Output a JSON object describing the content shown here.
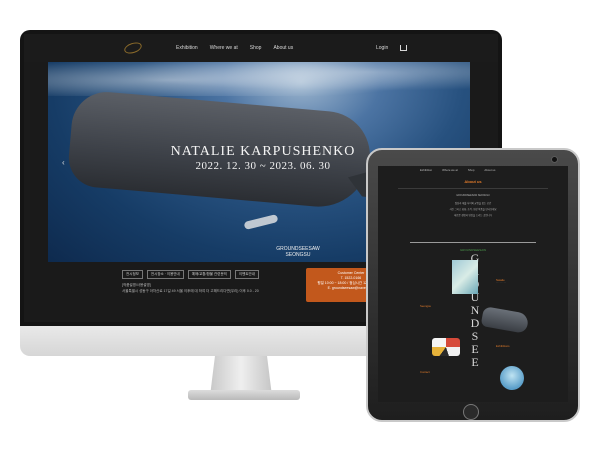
{
  "desktop": {
    "nav": {
      "links": [
        "Exhibition",
        "Where we at",
        "Shop",
        "About us"
      ],
      "login": "Login"
    },
    "hero": {
      "title": "NATALIE KARPUSHENKO",
      "dates": "2022. 12. 30 ~ 2023. 06. 30",
      "venue_line1": "GROUNDSEESAW",
      "venue_line2": "SEONGSU"
    },
    "tabs": [
      "전시정보",
      "전시장소 · 이용안내",
      "예매/교환/환불 관련문의",
      "이벤트안내"
    ],
    "info_heading": "[작품설명/사용설명]",
    "info_text": "서울특별시 성동구 아차산로 17길 49 서울 이후에 대 하여 더 고해드리다면(우리) 이후 0.0 - 20",
    "customer_center": {
      "title": "Customer Center",
      "phone": "T. 1522-0166",
      "hours": "평일 10:00 ~ 18:00 / 점심시간 12:00 ~ 13:00",
      "email": "E. groundseesaw@naver.com"
    }
  },
  "tablet": {
    "nav": [
      "Exhibition",
      "Where we at",
      "Shop",
      "About us"
    ],
    "title": "About us",
    "text_lines": [
      "GROUNDSEESAW SEONGSU",
      "일상과 예술 사이의 균형을 찾는 공간",
      "사진 그리고 회화, 조각, 영상 작품을 만나보세요",
      "새로운 경험과 영감을 드리는 곳입니다"
    ],
    "sub_heading": "GROUNDSEESAW",
    "vertical_word": [
      "G",
      "R",
      "O",
      "U",
      "N",
      "D",
      "S",
      "E",
      "E"
    ],
    "section_labels": [
      "Natalie",
      "Seongsu",
      "Exhibitions",
      "Contact"
    ]
  },
  "colors": {
    "accent_orange": "#c2581c",
    "site_bg": "#1b1b1b",
    "hero_ocean": "#27517f"
  }
}
